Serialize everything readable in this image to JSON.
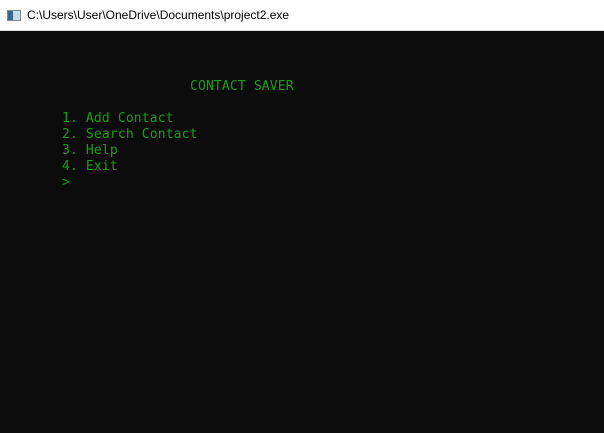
{
  "window": {
    "title": "C:\\Users\\User\\OneDrive\\Documents\\project2.exe",
    "icon": "console-app-icon"
  },
  "console": {
    "text_color": "#13a10e",
    "background": "#0c0c0c",
    "heading": "CONTACT SAVER",
    "menu": [
      "1. Add Contact",
      "2. Search Contact",
      "3. Help",
      "4. Exit"
    ],
    "prompt": ">"
  }
}
